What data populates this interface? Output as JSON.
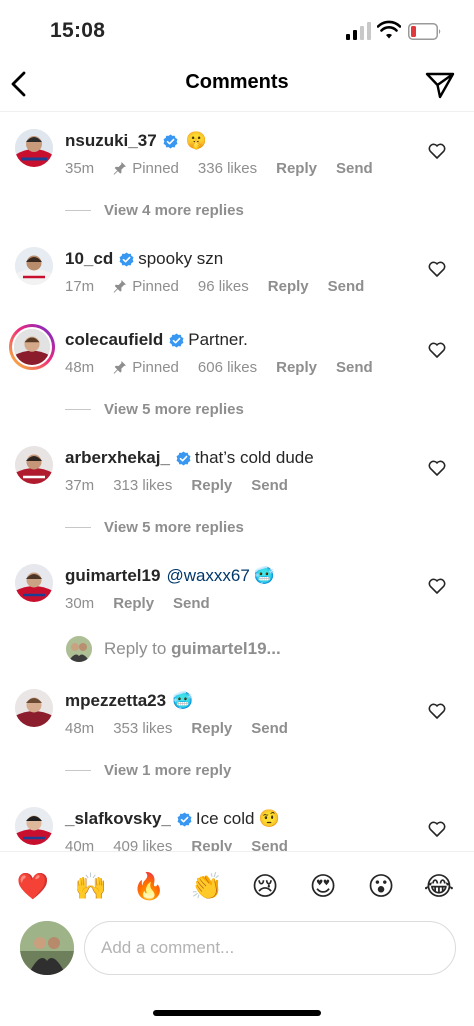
{
  "status": {
    "time": "15:08"
  },
  "nav": {
    "title": "Comments",
    "back_icon": "chevron-left-icon",
    "dm_icon": "paper-plane-icon"
  },
  "comments": [
    {
      "username": "nsuzuki_37",
      "verified": true,
      "text": "",
      "emoji": "🤫",
      "time": "35m",
      "pinned": "Pinned",
      "likes": "336 likes",
      "reply": "Reply",
      "send": "Send",
      "more": "View 4 more replies"
    },
    {
      "username": "10_cd",
      "verified": true,
      "text": "spooky szn",
      "emoji": "",
      "time": "17m",
      "pinned": "Pinned",
      "likes": "96 likes",
      "reply": "Reply",
      "send": "Send",
      "more": ""
    },
    {
      "username": "colecaufield",
      "verified": true,
      "text": "Partner.",
      "emoji": "",
      "time": "48m",
      "pinned": "Pinned",
      "likes": "606 likes",
      "reply": "Reply",
      "send": "Send",
      "more": "View 5 more replies"
    },
    {
      "username": "arberxhekaj_",
      "verified": true,
      "text": "that’s cold dude",
      "emoji": "",
      "time": "37m",
      "pinned": "",
      "likes": "313 likes",
      "reply": "Reply",
      "send": "Send",
      "more": "View 5 more replies"
    },
    {
      "username": "guimartel19",
      "verified": false,
      "text": "@waxxx67",
      "emoji": "🥶",
      "time": "30m",
      "pinned": "",
      "likes": "",
      "reply": "Reply",
      "send": "Send",
      "more": ""
    },
    {
      "username": "mpezzetta23",
      "verified": false,
      "text": "",
      "emoji": "🥶",
      "time": "48m",
      "pinned": "",
      "likes": "353 likes",
      "reply": "Reply",
      "send": "Send",
      "more": "View 1 more reply"
    },
    {
      "username": "_slafkovsky_",
      "verified": true,
      "text": "Ice cold",
      "emoji": "🤨",
      "time": "40m",
      "pinned": "",
      "likes": "409 likes",
      "reply": "Reply",
      "send": "Send",
      "more": ""
    }
  ],
  "reply_to": {
    "prefix": "Reply to",
    "username": "guimartel19..."
  },
  "emoji_bar": [
    "❤️",
    "🙌",
    "🔥",
    "👏",
    "😢",
    "😍",
    "😮",
    "😂"
  ],
  "composer": {
    "placeholder": "Add a comment..."
  },
  "colors": {
    "accent_blue": "#3897f0",
    "mention_blue": "#00376b",
    "muted": "#8e8e8e",
    "battery_red": "#e0393e"
  }
}
